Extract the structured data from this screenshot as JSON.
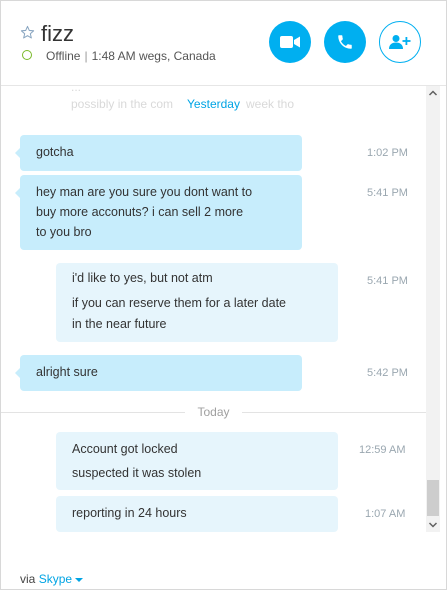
{
  "header": {
    "contact_name": "fizz",
    "status": "Offline",
    "local_time": "1:48 AM wegs, Canada",
    "icons": {
      "favorite": "star-outline-icon",
      "video": "video-camera-icon",
      "call": "phone-icon",
      "add": "add-contact-icon"
    }
  },
  "conversation": {
    "previous_preview_1": "...",
    "previous_preview_2": "possibly in the com",
    "previous_preview_3": "week tho",
    "date_yesterday": "Yesterday",
    "date_today": "Today",
    "messages": [
      {
        "lines": [
          "gotcha"
        ],
        "time": "1:02 PM"
      },
      {
        "lines": [
          "hey man are you sure you dont want to",
          "buy more acconuts? i can sell 2 more",
          "to you bro"
        ],
        "time": "5:41 PM"
      },
      {
        "lines": [
          "i'd like to yes, but not atm",
          "if you can reserve them for a later date",
          "in the near future"
        ],
        "time": "5:41 PM"
      },
      {
        "lines": [
          "alright sure"
        ],
        "time": "5:42 PM"
      },
      {
        "lines": [
          "Account got locked",
          "suspected it was stolen"
        ],
        "time": "12:59 AM"
      },
      {
        "lines": [
          "reporting in 24 hours"
        ],
        "time": "1:07 AM"
      }
    ]
  },
  "footer": {
    "via": "via",
    "service": "Skype"
  },
  "colors": {
    "accent": "#00aff0",
    "outgoing_bubble": "#c7edfc",
    "incoming_bubble": "#e6f5fc",
    "presence_offline": "#7ab929"
  }
}
